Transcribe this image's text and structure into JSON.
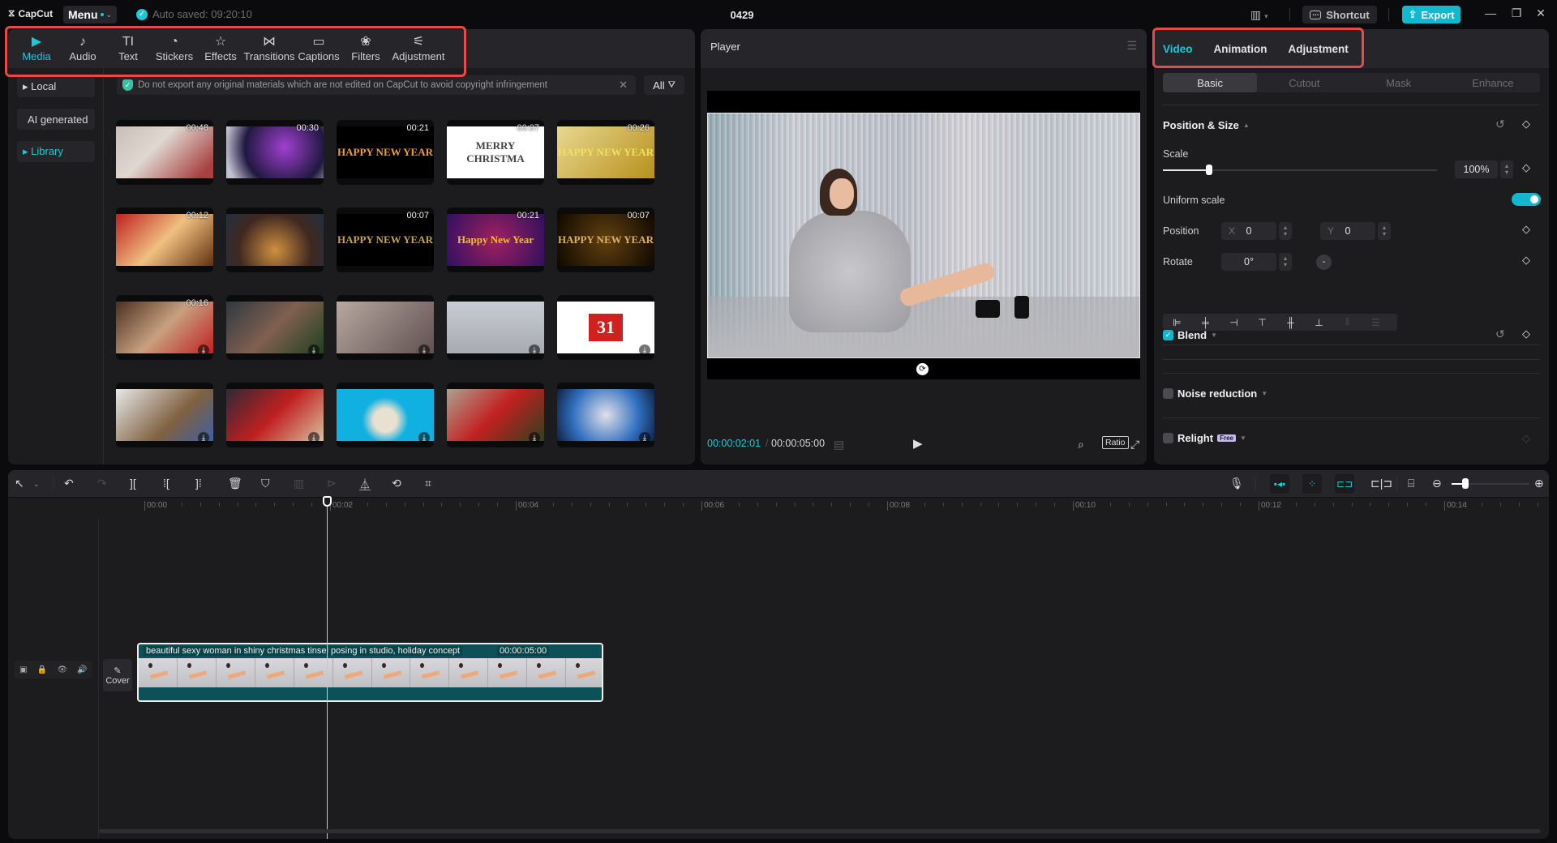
{
  "titlebar": {
    "app_name": "CapCut",
    "menu_label": "Menu",
    "autosave": "Auto saved: 09:20:10",
    "project_title": "0429",
    "shortcut_label": "Shortcut",
    "export_label": "Export"
  },
  "media_tabs": [
    {
      "label": "Media",
      "icon": "media-icon",
      "glyph": "▶",
      "active": true
    },
    {
      "label": "Audio",
      "icon": "audio-icon",
      "glyph": "♪",
      "active": false
    },
    {
      "label": "Text",
      "icon": "text-icon",
      "glyph": "TI",
      "active": false
    },
    {
      "label": "Stickers",
      "icon": "stickers-icon",
      "glyph": "◔",
      "active": false
    },
    {
      "label": "Effects",
      "icon": "effects-icon",
      "glyph": "☆",
      "active": false
    },
    {
      "label": "Transitions",
      "icon": "transitions-icon",
      "glyph": "⋈",
      "active": false
    },
    {
      "label": "Captions",
      "icon": "captions-icon",
      "glyph": "▭",
      "active": false
    },
    {
      "label": "Filters",
      "icon": "filters-icon",
      "glyph": "❀",
      "active": false
    },
    {
      "label": "Adjustment",
      "icon": "adjustment-icon",
      "glyph": "⚟",
      "active": false
    }
  ],
  "sidebar": {
    "items": [
      {
        "label": "▸ Local",
        "active": false
      },
      {
        "label": "AI generated",
        "active": false
      },
      {
        "label": "▸ Library",
        "active": true
      }
    ]
  },
  "notice": {
    "text": "Do not export any original materials which are not edited on CapCut to avoid copyright infringement",
    "filter_label": "All"
  },
  "thumbnails": [
    {
      "duration": "00:48",
      "download": false,
      "bg": "linear-gradient(135deg,#c8c0b8,#e0d8d0 40%,#a84040 90%)",
      "text": ""
    },
    {
      "duration": "00:30",
      "download": false,
      "bg": "radial-gradient(circle at 60% 40%,#a040d0,#201840 60%,#c0c0d0 90%)",
      "text": ""
    },
    {
      "duration": "00:21",
      "download": false,
      "bg": "#000",
      "text": "HAPPY NEW YEAR",
      "color": "#f0a030"
    },
    {
      "duration": "00:07",
      "download": false,
      "bg": "#fff",
      "text": "MERRY CHRISTMA",
      "color": "#444"
    },
    {
      "duration": "00:26",
      "download": false,
      "bg": "linear-gradient(135deg,#e8d890,#b8901c)",
      "text": "HAPPY NEW YEAR",
      "color": "#f0e060"
    },
    {
      "duration": "00:12",
      "download": false,
      "bg": "linear-gradient(135deg,#c02020,#f0c080 50%,#603010)",
      "text": ""
    },
    {
      "duration": "",
      "download": false,
      "bg": "radial-gradient(circle at 50% 70%,#d09040,#402820 60%,#203040)",
      "text": ""
    },
    {
      "duration": "00:07",
      "download": false,
      "bg": "#000",
      "text": "HAPPY NEW YEAR",
      "color": "#c8a050"
    },
    {
      "duration": "00:21",
      "download": false,
      "bg": "radial-gradient(circle,#a02060,#301060)",
      "text": "Happy New Year",
      "color": "#f0c030"
    },
    {
      "duration": "00:07",
      "download": false,
      "bg": "radial-gradient(circle,#604010,#100800)",
      "text": "HAPPY NEW YEAR",
      "color": "#e0b060"
    },
    {
      "duration": "00:16",
      "download": true,
      "bg": "linear-gradient(135deg,#4a3020,#c8a080 50%,#c02020)",
      "text": ""
    },
    {
      "duration": "",
      "download": true,
      "bg": "linear-gradient(135deg,#303840,#806050 50%,#204020)",
      "text": ""
    },
    {
      "duration": "",
      "download": true,
      "bg": "linear-gradient(135deg,#b8a8a0,#605050)",
      "text": ""
    },
    {
      "duration": "",
      "download": true,
      "bg": "linear-gradient(180deg,#c8ccd4,#a8aab0)",
      "text": ""
    },
    {
      "duration": "",
      "download": true,
      "bg": "#fff",
      "text": "31",
      "color": "#fff",
      "badge": "#d02020"
    },
    {
      "duration": "",
      "download": true,
      "bg": "linear-gradient(135deg,#e8e8e8,#806040 60%,#4060a0)",
      "text": ""
    },
    {
      "duration": "",
      "download": true,
      "bg": "linear-gradient(135deg,#302838,#c02020 50%,#d8c0a0)",
      "text": ""
    },
    {
      "duration": "",
      "download": true,
      "bg": "radial-gradient(circle at 50% 60%,#e8e0d0 20%,#10b0e0 40%)",
      "text": ""
    },
    {
      "duration": "",
      "download": true,
      "bg": "linear-gradient(135deg,#b0a090,#c02020 50%,#304020)",
      "text": ""
    },
    {
      "duration": "",
      "download": true,
      "bg": "radial-gradient(circle,#e0e0e8,#3070c0 60%,#102040)",
      "text": ""
    }
  ],
  "player": {
    "title": "Player",
    "current_time": "00:00:02:01",
    "total_time": "00:00:05:00",
    "ratio_label": "Ratio"
  },
  "right_panel": {
    "tabs": [
      {
        "label": "Video",
        "active": true
      },
      {
        "label": "Animation",
        "active": false
      },
      {
        "label": "Adjustment",
        "active": false
      }
    ],
    "subtabs": [
      {
        "label": "Basic",
        "active": true
      },
      {
        "label": "Cutout",
        "active": false
      },
      {
        "label": "Mask",
        "active": false
      },
      {
        "label": "Enhance",
        "active": false
      }
    ],
    "position_size": {
      "title": "Position & Size",
      "scale_label": "Scale",
      "scale_value": "100%",
      "scale_fraction": 0.17,
      "uniform_scale_label": "Uniform scale",
      "uniform_scale_on": true,
      "position_label": "Position",
      "x_label": "X",
      "x_value": "0",
      "y_label": "Y",
      "y_value": "0",
      "rotate_label": "Rotate",
      "rotate_value": "0°"
    },
    "blend": {
      "label": "Blend",
      "checked": true
    },
    "noise_reduction": {
      "label": "Noise reduction",
      "checked": false
    },
    "relight": {
      "label": "Relight",
      "checked": false,
      "badge": "Free"
    }
  },
  "timeline": {
    "ruler_labels": [
      "00:00",
      "00:02",
      "00:04",
      "00:06",
      "00:08",
      "00:10",
      "00:12",
      "00:14"
    ],
    "cover_label": "Cover",
    "clip": {
      "title": "beautiful sexy woman in shiny christmas tinsel posing in studio, holiday concept",
      "duration": "00:00:05:00"
    },
    "zoom_fraction": 0.18
  },
  "colors": {
    "accent": "#1ec8d8",
    "export": "#12b9cc",
    "highlight_box": "#e84a4a",
    "clip": "#0c5158"
  }
}
